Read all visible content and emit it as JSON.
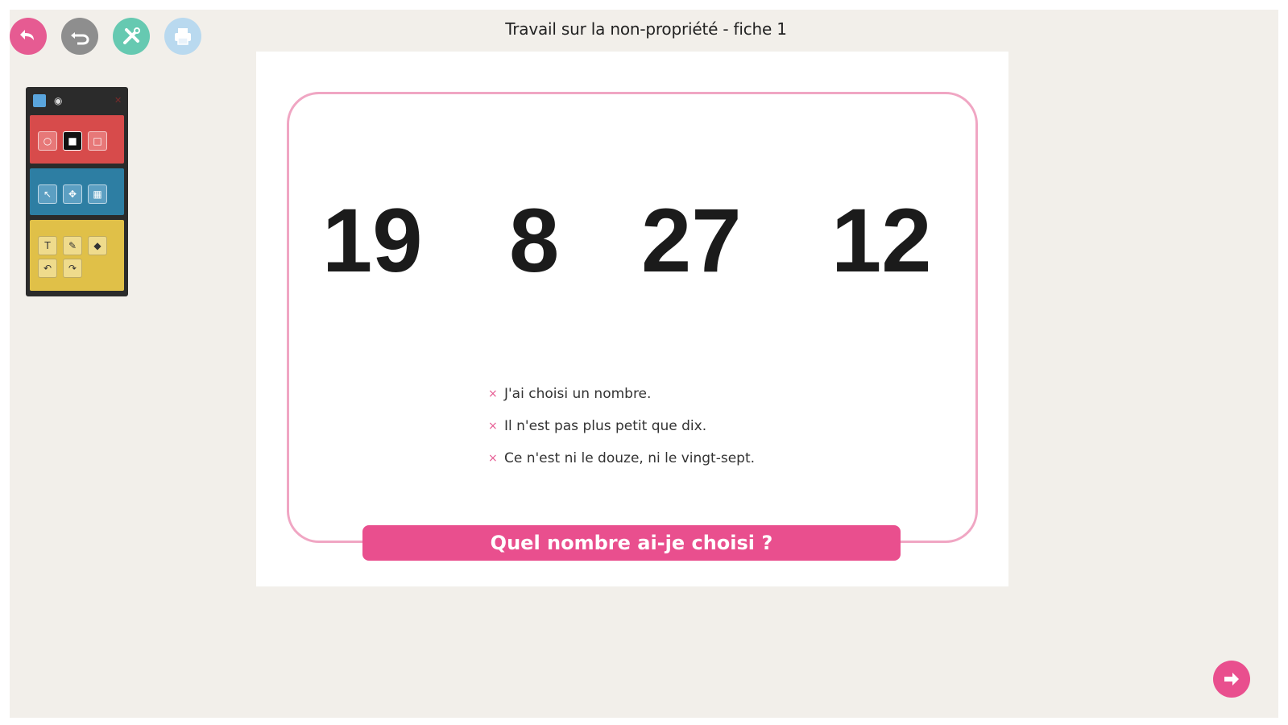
{
  "window": {
    "title": "Travail sur la non-propriété - fiche 1"
  },
  "toolbar": {
    "buttons": [
      {
        "icon": "back-arrow-icon",
        "color": "#e65b92"
      },
      {
        "icon": "undo-icon",
        "color": "#8e8e8e"
      },
      {
        "icon": "tools-icon",
        "color": "#66c9b1"
      },
      {
        "icon": "print-icon",
        "color": "#b9d9ef"
      }
    ]
  },
  "palette": {
    "header_icons": [
      "save-icon",
      "eye-icon",
      "close-icon"
    ],
    "sections": [
      {
        "color": "#d74b4b",
        "tools": [
          "circle-tool-icon",
          "square-fill-tool-icon",
          "square-tool-icon"
        ]
      },
      {
        "color": "#2d7ea3",
        "tools": [
          "select-tool-icon",
          "move-tool-icon",
          "delete-tool-icon"
        ]
      },
      {
        "color": "#e0c048",
        "tools": [
          "text-tool-icon",
          "pencil-tool-icon",
          "eraser-tool-icon",
          "undo-tool-icon",
          "redo-tool-icon"
        ]
      }
    ]
  },
  "slide": {
    "numbers": [
      "19",
      "8",
      "27",
      "12"
    ],
    "clues": [
      "J'ai choisi un nombre.",
      "Il n'est pas plus petit que dix.",
      "Ce n'est ni le douze, ni le vingt-sept."
    ],
    "clue_bullet": "×",
    "question": "Quel nombre ai-je choisi ?",
    "accent_color": "#e94f8e",
    "border_color": "#f0a6c3"
  },
  "navigation": {
    "next_icon": "next-arrow-icon"
  }
}
